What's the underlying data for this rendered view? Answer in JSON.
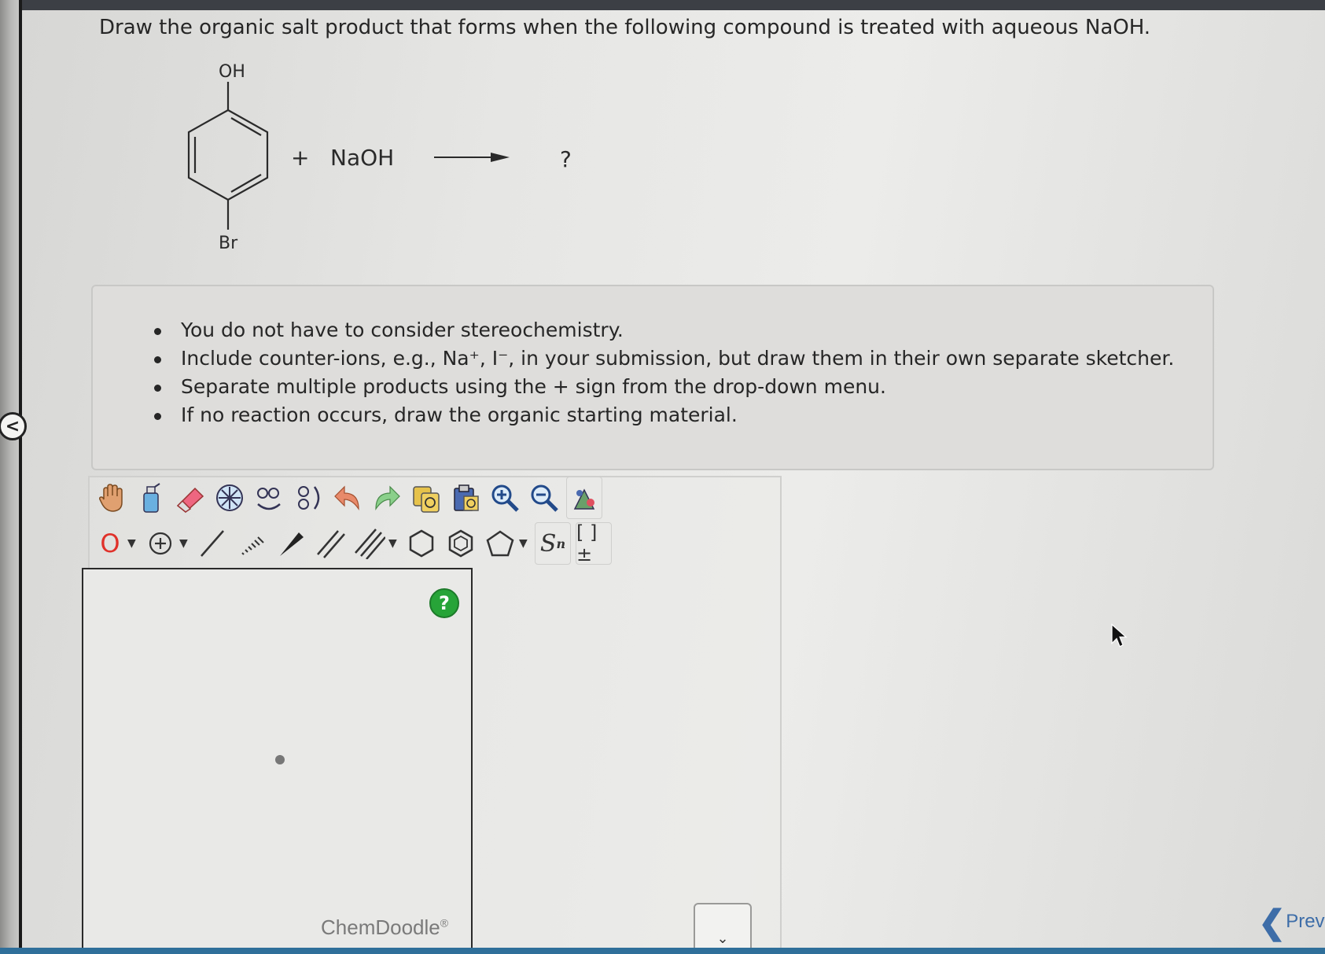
{
  "question": "Draw the organic salt product that forms when the following compound is treated with aqueous NaOH.",
  "reaction": {
    "substituent_top": "OH",
    "substituent_bottom": "Br",
    "plus": "+",
    "reagent": "NaOH",
    "product": "?"
  },
  "instructions": [
    "You do not have to consider stereochemistry.",
    "Include counter-ions, e.g., Na⁺, I⁻, in your submission, but draw them in their own separate sketcher.",
    "Separate multiple products using the + sign from the drop-down menu.",
    "If no reaction occurs, draw the organic starting material."
  ],
  "toolbar": {
    "atom_label": "O",
    "template_label": "S",
    "template_sub": "n",
    "bracket_label": "[ ]±"
  },
  "canvas": {
    "help": "?",
    "brand": "ChemDoodle",
    "brand_mark": "®"
  },
  "nav": {
    "collapse": "<",
    "previous": "Previ"
  },
  "colors": {
    "atom_red": "#e0312a",
    "help_green": "#27a438",
    "link_blue": "#3d6da8"
  }
}
